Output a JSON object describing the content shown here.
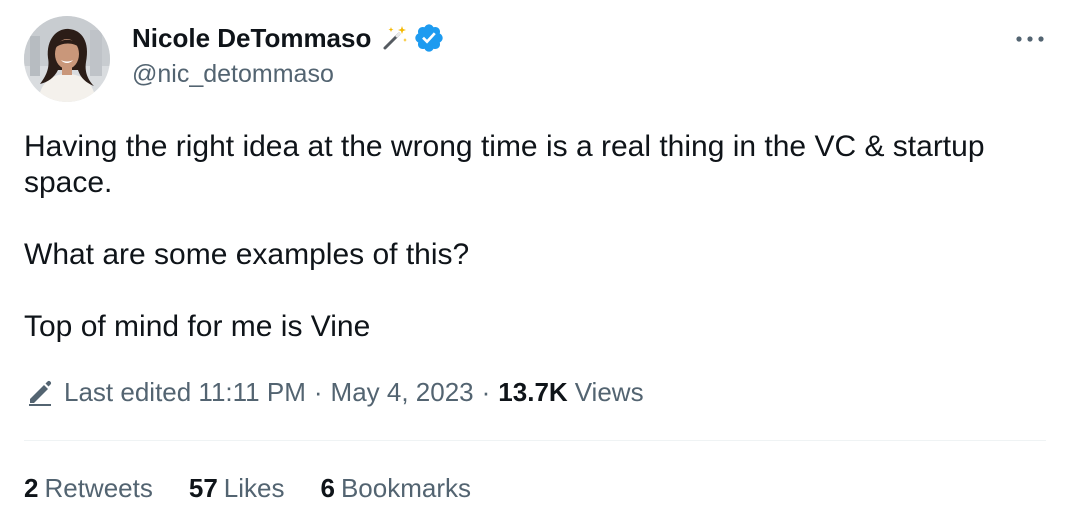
{
  "author": {
    "display_name": "Nicole DeTommaso",
    "handle": "@nic_detommaso",
    "name_emoji_icon": "magic-wand-icon",
    "verified_icon": "verified-badge-icon",
    "verified_color": "#1d9bf0"
  },
  "tweet": {
    "paragraphs": [
      "Having the right idea at the wrong time is a real thing in the VC & startup space.",
      "What are some examples of this?",
      "Top of mind for me is Vine"
    ]
  },
  "meta": {
    "edit_icon": "pencil-icon",
    "edited_label": "Last edited 11:11 PM",
    "separator": "·",
    "date": "May 4, 2023",
    "views_count": "13.7K",
    "views_label": "Views"
  },
  "stats": {
    "retweets_count": "2",
    "retweets_label": "Retweets",
    "likes_count": "57",
    "likes_label": "Likes",
    "bookmarks_count": "6",
    "bookmarks_label": "Bookmarks"
  },
  "colors": {
    "text_primary": "#0f1419",
    "text_secondary": "#536471",
    "divider": "#eff3f4"
  }
}
